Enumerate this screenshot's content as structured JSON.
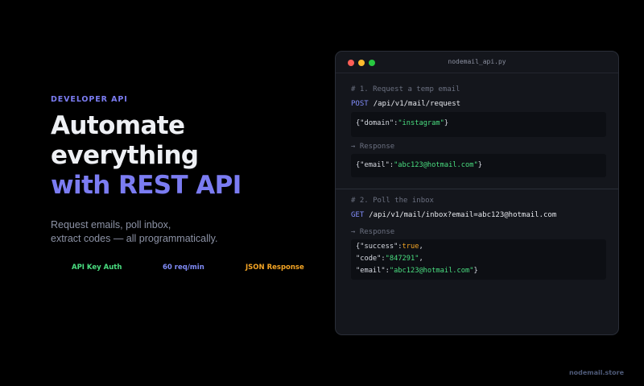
{
  "hero": {
    "eyebrow": "DEVELOPER API",
    "headline_line1": "Automate",
    "headline_line2": "everything",
    "headline_line3": "with REST API",
    "sub_line1": "Request emails, poll inbox,",
    "sub_line2": "extract codes — all programmatically."
  },
  "badges": [
    "API Key Auth",
    "60 req/min",
    "JSON Response"
  ],
  "window": {
    "filename": "nodemail_api.py",
    "step1": {
      "comment": "# 1. Request a temp email",
      "method": "POST",
      "path": "/api/v1/mail/request",
      "body_key": "{\"domain\":",
      "body_value": "\"instagram\"",
      "body_end": "}",
      "response_label": "→ Response",
      "resp_key": "{\"email\":",
      "resp_value": "\"abc123@hotmail.com\"",
      "resp_end": "}"
    },
    "step2": {
      "comment": "# 2. Poll the inbox",
      "method": "GET",
      "path": "/api/v1/mail/inbox?email=abc123@hotmail.com",
      "response_label": "→ Response",
      "line1_key": "{\"success\":",
      "line1_value": "true",
      "line1_end": ",",
      "line2_key": "\"code\":",
      "line2_value": "\"847291\"",
      "line2_end": ",",
      "line3_key": "\"email\":",
      "line3_value": "\"abc123@hotmail.com\"",
      "line3_end": "}"
    }
  },
  "footer": "nodemail.store",
  "colors": {
    "accent": "#7b7cf2",
    "green": "#4ade80",
    "orange": "#f5a524",
    "background": "#000000",
    "window_bg": "#14161c"
  }
}
